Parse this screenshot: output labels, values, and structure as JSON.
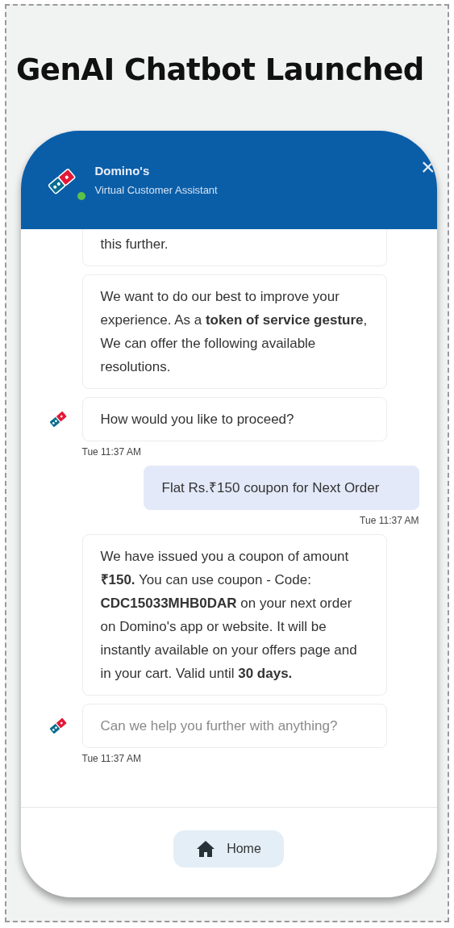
{
  "slide_title": "GenAI Chatbot Launched",
  "chat_header": {
    "title": "Domino's",
    "subtitle": "Virtual Customer Assistant",
    "online": true,
    "close": "×"
  },
  "messages": [
    {
      "kind": "bot",
      "text": "this further.",
      "cut_top": true,
      "avatar": false
    },
    {
      "kind": "bot",
      "text": "We want to do our best to improve your experience. As a **token of service gesture**, We can offer the following available resolutions.",
      "avatar": false
    },
    {
      "kind": "bot",
      "text": "How would you like to proceed?",
      "avatar": true,
      "time": "Tue 11:37 AM"
    },
    {
      "kind": "user",
      "text": "Flat Rs.₹150 coupon for Next Order",
      "time": "Tue 11:37 AM"
    },
    {
      "kind": "bot",
      "text": "We have issued you a coupon of amount **₹150.** You can use coupon - Code: **CDC15033MHB0DAR** on your next order on Domino's app or website. It will be instantly available on your offers page and in your cart. Valid until **30 days.**",
      "avatar": false
    },
    {
      "kind": "bot",
      "text": "Can we help you further with anything?",
      "avatar": true,
      "faded": true,
      "time": "Tue 11:37 AM"
    }
  ],
  "footer": {
    "home_button": "Home"
  }
}
